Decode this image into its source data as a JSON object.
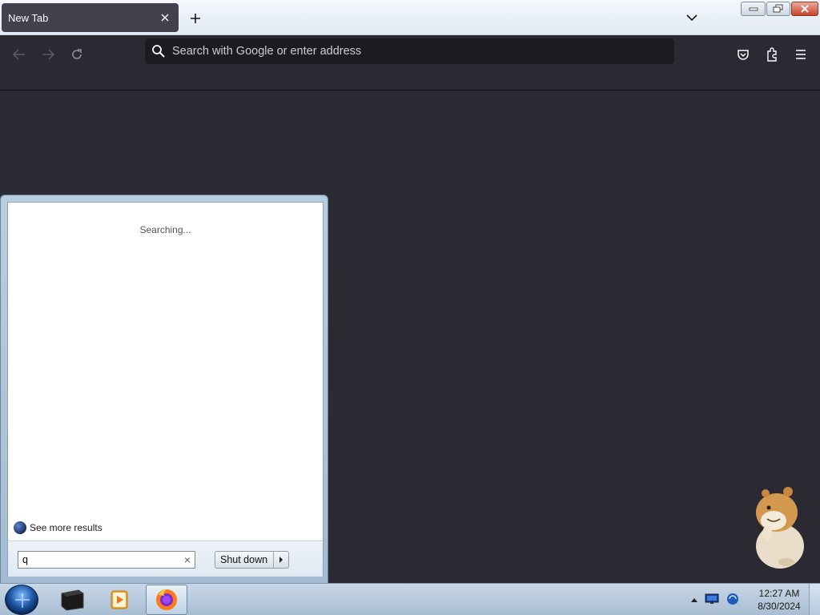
{
  "browser": {
    "tab": {
      "title": "New Tab"
    },
    "urlbar": {
      "placeholder": "Search with Google or enter address"
    }
  },
  "start_menu": {
    "status_text": "Searching...",
    "see_more": "See more results",
    "search_value": "q",
    "shutdown_label": "Shut down"
  },
  "taskbar": {
    "time": "12:27 AM",
    "date": "8/30/2024"
  },
  "colors": {
    "browser_bg": "#2b2a33",
    "urlbar_bg": "#1c1b22",
    "tab_bg": "#42414d"
  }
}
